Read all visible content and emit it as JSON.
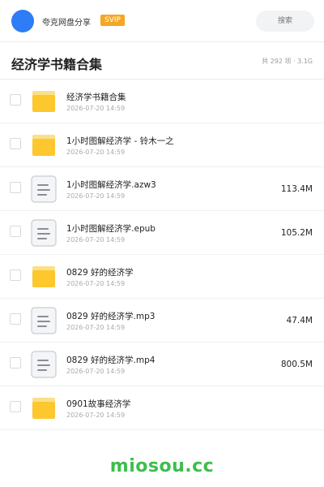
{
  "topbar": {
    "username": "夸克网盘分享",
    "badge": "SVIP",
    "search_placeholder": "搜索"
  },
  "header": {
    "title": "经济学书籍合集",
    "summary": "共 292 项 · 3.1G"
  },
  "files": [
    {
      "name": "经济学书籍合集",
      "date": "2026-07-20 14:59",
      "size": "",
      "type": "folder"
    },
    {
      "name": "1小时图解经济学 - 铃木一之",
      "date": "2026-07-20 14:59",
      "size": "",
      "type": "folder"
    },
    {
      "name": "1小时图解经济学.azw3",
      "date": "2026-07-20 14:59",
      "size": "113.4M",
      "type": "doc"
    },
    {
      "name": "1小时图解经济学.epub",
      "date": "2026-07-20 14:59",
      "size": "105.2M",
      "type": "doc"
    },
    {
      "name": "0829 好的经济学",
      "date": "2026-07-20 14:59",
      "size": "",
      "type": "folder"
    },
    {
      "name": "0829 好的经济学.mp3",
      "date": "2026-07-20 14:59",
      "size": "47.4M",
      "type": "doc"
    },
    {
      "name": "0829 好的经济学.mp4",
      "date": "2026-07-20 14:59",
      "size": "800.5M",
      "type": "doc"
    },
    {
      "name": "0901故事经济学",
      "date": "2026-07-20 14:59",
      "size": "",
      "type": "folder"
    }
  ],
  "icons": {
    "folder": "folder-icon",
    "doc": "document-icon"
  },
  "colors": {
    "folder": "#fdc72e",
    "folder_tab": "#fbe08a",
    "doc_border": "#c9ccd1",
    "doc_bg": "#f4f5f7",
    "accent": "#2e7cf6",
    "badge": "#f5a623",
    "watermark": "#3bbf4a"
  },
  "watermark": "miosou.cc"
}
